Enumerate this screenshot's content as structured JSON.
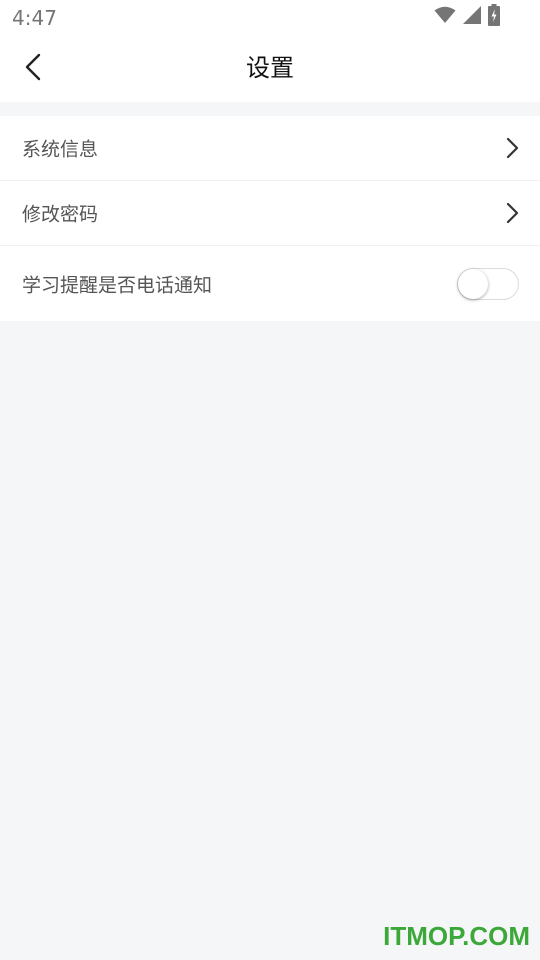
{
  "status_bar": {
    "time": "4:47",
    "icons": [
      "wifi-icon",
      "cell-signal-icon",
      "battery-charging-icon"
    ]
  },
  "header": {
    "title": "设置",
    "back_icon": "chevron-left-icon"
  },
  "settings": {
    "items": [
      {
        "label": "系统信息",
        "control": "chevron"
      },
      {
        "label": "修改密码",
        "control": "chevron"
      },
      {
        "label": "学习提醒是否电话通知",
        "control": "toggle",
        "toggle_on": false
      }
    ]
  },
  "watermark": "ITMOP.COM",
  "colors": {
    "background": "#f5f6f8",
    "surface": "#ffffff",
    "watermark": "#3ca83a"
  }
}
